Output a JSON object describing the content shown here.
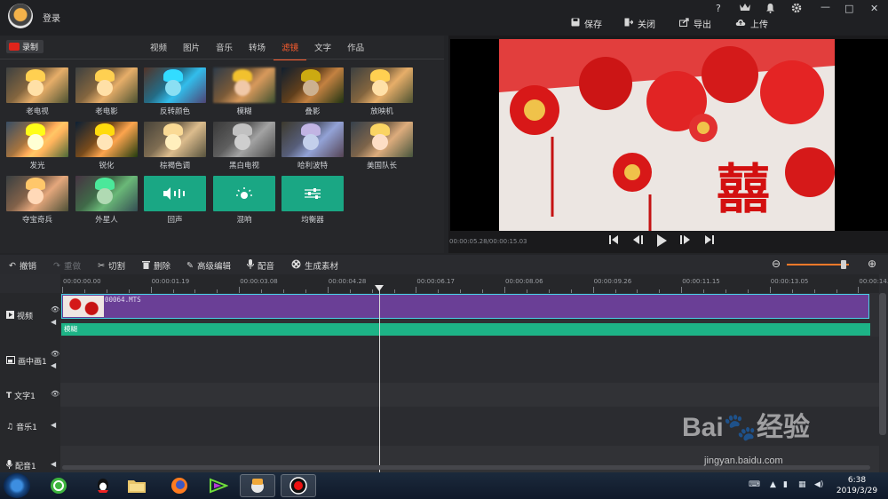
{
  "app": {
    "login_label": "登录",
    "window_controls": [
      "?",
      "VIP",
      "bell",
      "gear",
      "—",
      "□",
      "✕"
    ],
    "actions": [
      {
        "label": "保存",
        "icon": "save-icon"
      },
      {
        "label": "关闭",
        "icon": "exit-icon"
      },
      {
        "label": "导出",
        "icon": "export-icon"
      },
      {
        "label": "上传",
        "icon": "upload-icon"
      }
    ]
  },
  "media": {
    "record_label": "录制",
    "tabs": [
      "视频",
      "图片",
      "音乐",
      "转场",
      "滤镜",
      "文字",
      "作品"
    ],
    "active_tab": "滤镜",
    "filters": [
      {
        "label": "老电视",
        "style": "old"
      },
      {
        "label": "老电影",
        "style": "old"
      },
      {
        "label": "反转颜色",
        "style": "inv"
      },
      {
        "label": "模糊",
        "style": "blur"
      },
      {
        "label": "叠影",
        "style": "ghost"
      },
      {
        "label": "放映机",
        "style": "old"
      },
      {
        "label": "发光",
        "style": "glow"
      },
      {
        "label": "锐化",
        "style": "sharp"
      },
      {
        "label": "棕褐色调",
        "style": "brown"
      },
      {
        "label": "黑白电视",
        "style": "bw"
      },
      {
        "label": "哈利波特",
        "style": "harry"
      },
      {
        "label": "美国队长",
        "style": "usa"
      },
      {
        "label": "夺宝奇兵",
        "style": "treasure"
      },
      {
        "label": "外星人",
        "style": "alien"
      },
      {
        "label": "回声",
        "style": "audio",
        "icon": "echo-icon"
      },
      {
        "label": "混响",
        "style": "audio",
        "icon": "reverb-icon"
      },
      {
        "label": "均衡器",
        "style": "audio",
        "icon": "equalizer-icon"
      }
    ]
  },
  "preview": {
    "timecode": "00:00:05.28/00:00:15.03",
    "controls": [
      "skip-start-icon",
      "step-back-icon",
      "play-icon",
      "step-forward-icon",
      "skip-end-icon"
    ]
  },
  "toolbar": {
    "undo": "撤销",
    "redo": "重做",
    "cut": "切割",
    "delete": "删除",
    "advanced_edit": "高级编辑",
    "dub": "配音",
    "generate": "生成素材"
  },
  "timeline": {
    "ticks": [
      "00:00:00.00",
      "00:00:01.19",
      "00:00:03.08",
      "00:00:04.28",
      "00:00:06.17",
      "00:00:08.06",
      "00:00:09.26",
      "00:00:11.15",
      "00:00:13.05",
      "00:00:14."
    ],
    "tracks": [
      "视频",
      "画中画1",
      "文字1",
      "音乐1",
      "配音1"
    ],
    "clip_name": "00064.MTS",
    "filter_label": "模糊"
  },
  "taskbar": {
    "time": "6:38",
    "date": "2019/3/29"
  },
  "watermark": {
    "brand": "Bai du 经验",
    "url": "jingyan.baidu.com"
  },
  "colors": {
    "accent": "#ff5e2e",
    "clip": "#6a3f96",
    "filter_track": "#1db386",
    "record": "#e0241b"
  }
}
